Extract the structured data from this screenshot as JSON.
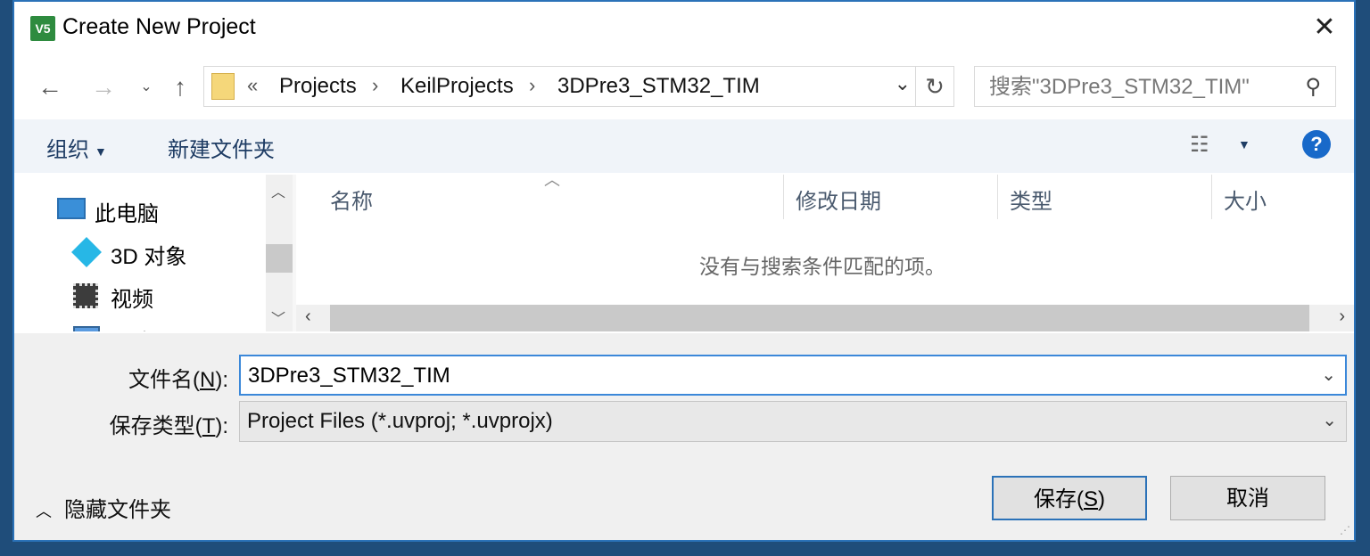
{
  "window": {
    "title": "Create New Project",
    "app_icon_text": "V5"
  },
  "nav": {
    "breadcrumb": [
      "Projects",
      "KeilProjects",
      "3DPre3_STM32_TIM"
    ],
    "overflow_marker": "«",
    "search_placeholder": "搜索\"3DPre3_STM32_TIM\""
  },
  "toolbar": {
    "organize": "组织",
    "new_folder": "新建文件夹"
  },
  "nav_pane": {
    "items": [
      {
        "label": "此电脑",
        "icon": "computer-icon"
      },
      {
        "label": "3D 对象",
        "icon": "3d-objects-icon"
      },
      {
        "label": "视频",
        "icon": "video-icon"
      },
      {
        "label": "图片",
        "icon": "pictures-icon"
      }
    ]
  },
  "file_list": {
    "columns": [
      "名称",
      "修改日期",
      "类型",
      "大小"
    ],
    "empty_message": "没有与搜索条件匹配的项。"
  },
  "form": {
    "filename_label": "文件名(",
    "filename_key": "N",
    "filename_label_end": "):",
    "filename_value": "3DPre3_STM32_TIM",
    "filetype_label": "保存类型(",
    "filetype_key": "T",
    "filetype_label_end": "):",
    "filetype_value": "Project Files (*.uvproj; *.uvprojx)"
  },
  "footer": {
    "hide_folders": "隐藏文件夹",
    "save_label": "保存(",
    "save_key": "S",
    "save_label_end": ")",
    "cancel": "取消"
  },
  "colors": {
    "accent": "#2b72b8",
    "toolbar_bg": "#f0f4f9",
    "footer_bg": "#f0f0f0"
  }
}
